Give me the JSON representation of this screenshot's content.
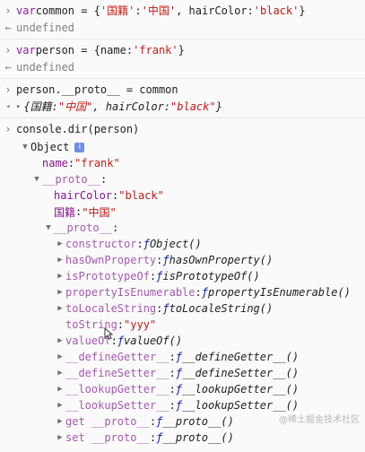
{
  "commands": [
    {
      "input_parts": [
        {
          "t": "var ",
          "c": "kw"
        },
        {
          "t": "common = {",
          "c": "plain"
        },
        {
          "t": "'国籍'",
          "c": "str"
        },
        {
          "t": ":",
          "c": "plain"
        },
        {
          "t": "'中国'",
          "c": "str"
        },
        {
          "t": ", hairColor: ",
          "c": "plain"
        },
        {
          "t": "'black'",
          "c": "str"
        },
        {
          "t": "}",
          "c": "plain"
        }
      ],
      "output": "undefined"
    },
    {
      "input_parts": [
        {
          "t": "var ",
          "c": "kw"
        },
        {
          "t": "person = {name:",
          "c": "plain"
        },
        {
          "t": "'frank'",
          "c": "str"
        },
        {
          "t": "}",
          "c": "plain"
        }
      ],
      "output": "undefined"
    },
    {
      "input_parts": [
        {
          "t": "person.__proto__ = common",
          "c": "plain"
        }
      ],
      "output_parts": [
        {
          "t": "{国籍: ",
          "c": "ital"
        },
        {
          "t": "\"中国\"",
          "c": "str ital"
        },
        {
          "t": ", hairColor: ",
          "c": "ital"
        },
        {
          "t": "\"black\"",
          "c": "str ital"
        },
        {
          "t": "}",
          "c": "ital"
        }
      ]
    }
  ],
  "dir_command": "console.dir(person)",
  "tree": [
    {
      "indent": 0,
      "arrow": "down",
      "parts": [
        {
          "t": "Object",
          "c": "plain"
        }
      ],
      "badge": "i"
    },
    {
      "indent": 1,
      "arrow": "",
      "parts": [
        {
          "t": "name",
          "c": "prop"
        },
        {
          "t": ": ",
          "c": "plain"
        },
        {
          "t": "\"frank\"",
          "c": "str"
        }
      ]
    },
    {
      "indent": 1,
      "arrow": "down",
      "parts": [
        {
          "t": "__proto__",
          "c": "gray-prop"
        },
        {
          "t": ":",
          "c": "plain"
        }
      ]
    },
    {
      "indent": 2,
      "arrow": "",
      "parts": [
        {
          "t": "hairColor",
          "c": "prop"
        },
        {
          "t": ": ",
          "c": "plain"
        },
        {
          "t": "\"black\"",
          "c": "str"
        }
      ]
    },
    {
      "indent": 2,
      "arrow": "",
      "parts": [
        {
          "t": "国籍",
          "c": "prop"
        },
        {
          "t": ": ",
          "c": "plain"
        },
        {
          "t": "\"中国\"",
          "c": "str"
        }
      ]
    },
    {
      "indent": 2,
      "arrow": "down",
      "parts": [
        {
          "t": "__proto__",
          "c": "gray-prop"
        },
        {
          "t": ":",
          "c": "plain"
        }
      ]
    },
    {
      "indent": 3,
      "arrow": "right",
      "parts": [
        {
          "t": "constructor",
          "c": "gray-prop"
        },
        {
          "t": ": ",
          "c": "plain"
        },
        {
          "t": "ƒ ",
          "c": "fn"
        },
        {
          "t": "Object()",
          "c": "fname"
        }
      ]
    },
    {
      "indent": 3,
      "arrow": "right",
      "parts": [
        {
          "t": "hasOwnProperty",
          "c": "gray-prop"
        },
        {
          "t": ": ",
          "c": "plain"
        },
        {
          "t": "ƒ ",
          "c": "fn"
        },
        {
          "t": "hasOwnProperty()",
          "c": "fname"
        }
      ]
    },
    {
      "indent": 3,
      "arrow": "right",
      "parts": [
        {
          "t": "isPrototypeOf",
          "c": "gray-prop"
        },
        {
          "t": ": ",
          "c": "plain"
        },
        {
          "t": "ƒ ",
          "c": "fn"
        },
        {
          "t": "isPrototypeOf()",
          "c": "fname"
        }
      ]
    },
    {
      "indent": 3,
      "arrow": "right",
      "parts": [
        {
          "t": "propertyIsEnumerable",
          "c": "gray-prop"
        },
        {
          "t": ": ",
          "c": "plain"
        },
        {
          "t": "ƒ ",
          "c": "fn"
        },
        {
          "t": "propertyIsEnumerable()",
          "c": "fname"
        }
      ]
    },
    {
      "indent": 3,
      "arrow": "right",
      "parts": [
        {
          "t": "toLocaleString",
          "c": "gray-prop"
        },
        {
          "t": ": ",
          "c": "plain"
        },
        {
          "t": "ƒ ",
          "c": "fn"
        },
        {
          "t": "toLocaleString()",
          "c": "fname"
        }
      ]
    },
    {
      "indent": 3,
      "arrow": "",
      "parts": [
        {
          "t": "toString",
          "c": "gray-prop"
        },
        {
          "t": ": ",
          "c": "plain"
        },
        {
          "t": "\"yyy\"",
          "c": "str"
        }
      ]
    },
    {
      "indent": 3,
      "arrow": "right",
      "parts": [
        {
          "t": "valueOf",
          "c": "gray-prop"
        },
        {
          "t": ": ",
          "c": "plain"
        },
        {
          "t": "ƒ ",
          "c": "fn"
        },
        {
          "t": "valueOf()",
          "c": "fname"
        }
      ]
    },
    {
      "indent": 3,
      "arrow": "right",
      "parts": [
        {
          "t": "__defineGetter__",
          "c": "gray-prop"
        },
        {
          "t": ": ",
          "c": "plain"
        },
        {
          "t": "ƒ ",
          "c": "fn"
        },
        {
          "t": "__defineGetter__()",
          "c": "fname"
        }
      ]
    },
    {
      "indent": 3,
      "arrow": "right",
      "parts": [
        {
          "t": "__defineSetter__",
          "c": "gray-prop"
        },
        {
          "t": ": ",
          "c": "plain"
        },
        {
          "t": "ƒ ",
          "c": "fn"
        },
        {
          "t": "__defineSetter__()",
          "c": "fname"
        }
      ]
    },
    {
      "indent": 3,
      "arrow": "right",
      "parts": [
        {
          "t": "__lookupGetter__",
          "c": "gray-prop"
        },
        {
          "t": ": ",
          "c": "plain"
        },
        {
          "t": "ƒ ",
          "c": "fn"
        },
        {
          "t": "__lookupGetter__()",
          "c": "fname"
        }
      ]
    },
    {
      "indent": 3,
      "arrow": "right",
      "parts": [
        {
          "t": "__lookupSetter__",
          "c": "gray-prop"
        },
        {
          "t": ": ",
          "c": "plain"
        },
        {
          "t": "ƒ ",
          "c": "fn"
        },
        {
          "t": "__lookupSetter__()",
          "c": "fname"
        }
      ]
    },
    {
      "indent": 3,
      "arrow": "right",
      "parts": [
        {
          "t": "get __proto__",
          "c": "gray-prop"
        },
        {
          "t": ": ",
          "c": "plain"
        },
        {
          "t": "ƒ ",
          "c": "fn"
        },
        {
          "t": "__proto__()",
          "c": "fname"
        }
      ]
    },
    {
      "indent": 3,
      "arrow": "right",
      "parts": [
        {
          "t": "set __proto__",
          "c": "gray-prop"
        },
        {
          "t": ": ",
          "c": "plain"
        },
        {
          "t": "ƒ ",
          "c": "fn"
        },
        {
          "t": "__proto__()",
          "c": "fname"
        }
      ]
    }
  ],
  "watermark": "@稀土掘金技术社区",
  "colors": {
    "string": "#c41a16",
    "keyword": "#8e1d9b",
    "property": "#881391",
    "badge": "#6e8ee4"
  }
}
